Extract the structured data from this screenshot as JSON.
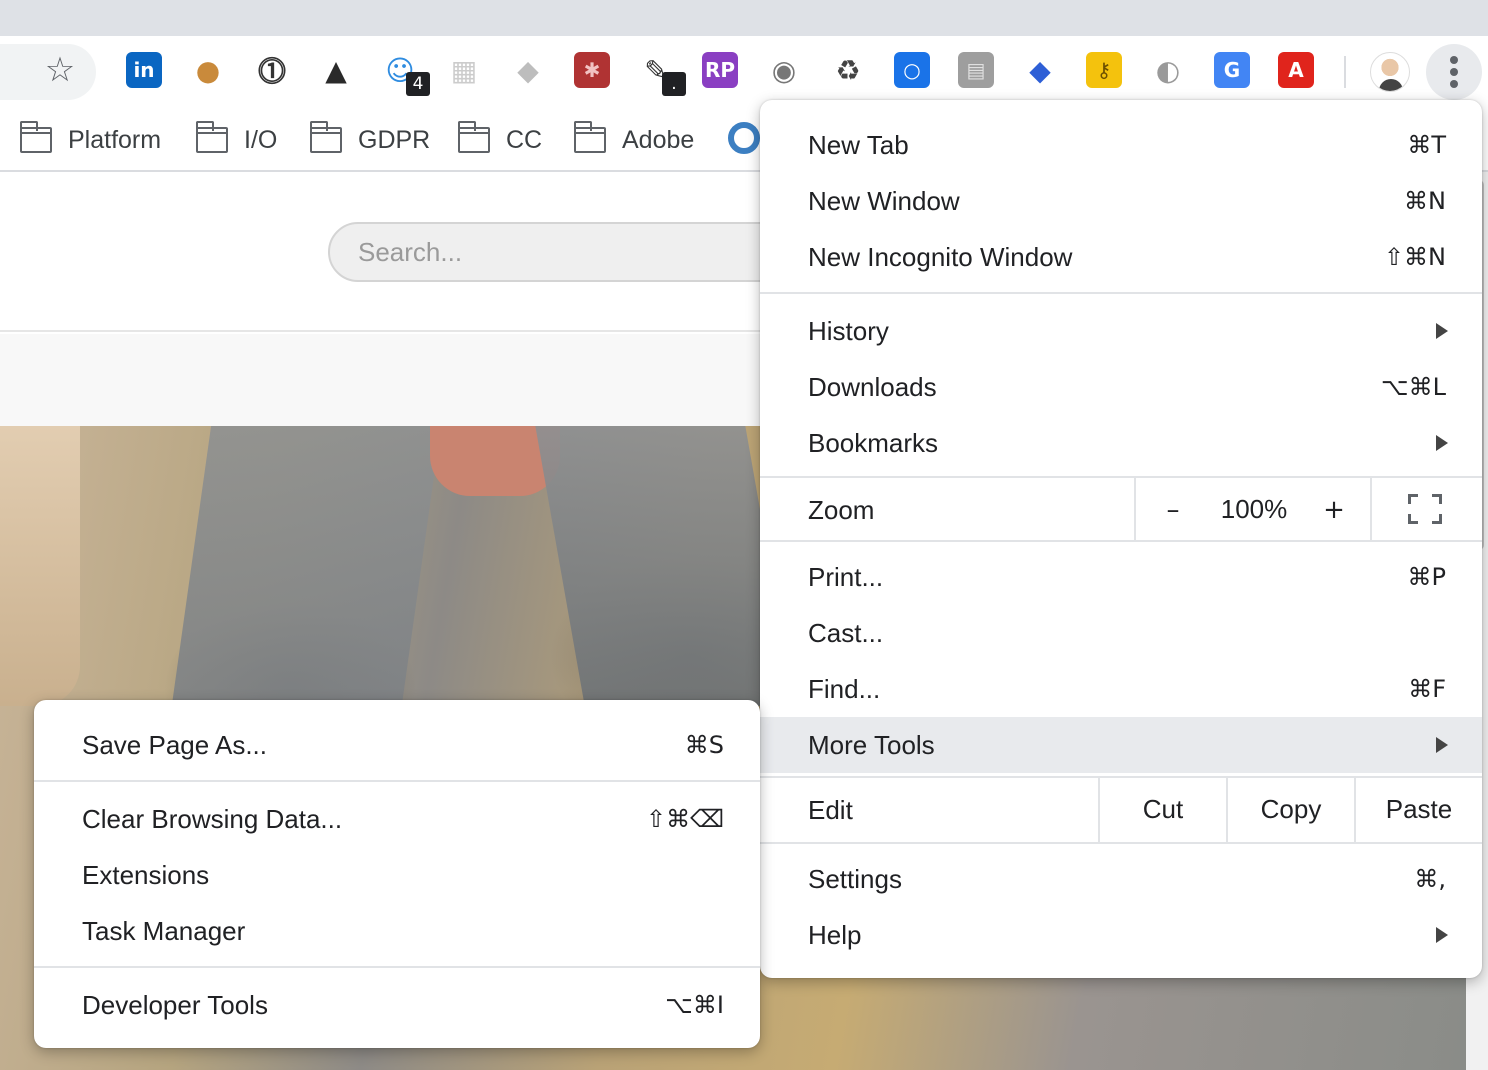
{
  "toolbar": {
    "bookmark_star_icon": "star-icon",
    "extensions": [
      {
        "name": "linkedin-extension-icon",
        "glyph": "in",
        "bg": "#0a66c2",
        "fg": "#ffffff"
      },
      {
        "name": "cookie-extension-icon",
        "glyph": "●",
        "bg": "#ffffff",
        "fg": "#c98a3b"
      },
      {
        "name": "password-manager-extension-icon",
        "glyph": "⓵",
        "bg": "#ffffff",
        "fg": "#333333"
      },
      {
        "name": "color-triangle-extension-icon",
        "glyph": "▲",
        "bg": "#ffffff",
        "fg": "#2a2a2a"
      },
      {
        "name": "ghost-extension-icon",
        "glyph": "☺",
        "bg": "#ffffff",
        "fg": "#2f8ce0",
        "badge": "4"
      },
      {
        "name": "map-extension-icon",
        "glyph": "▦",
        "bg": "#ffffff",
        "fg": "#cccccc"
      },
      {
        "name": "cube-extension-icon",
        "glyph": "◆",
        "bg": "#ffffff",
        "fg": "#bdbdbd"
      },
      {
        "name": "red-square-extension-icon",
        "glyph": "✱",
        "bg": "#b03333",
        "fg": "#f2c2c2"
      },
      {
        "name": "eyedropper-extension-icon",
        "glyph": "✎",
        "bg": "#ffffff",
        "fg": "#333333",
        "badge": "."
      },
      {
        "name": "rp-extension-icon",
        "glyph": "RP",
        "bg": "#8a3fc2",
        "fg": "#ffffff"
      },
      {
        "name": "camera-extension-icon",
        "glyph": "◉",
        "bg": "#ffffff",
        "fg": "#777777"
      },
      {
        "name": "recycle-extension-icon",
        "glyph": "♻",
        "bg": "#ffffff",
        "fg": "#444444"
      },
      {
        "name": "blue-ring-extension-icon",
        "glyph": "○",
        "bg": "#1a73e8",
        "fg": "#ffffff"
      },
      {
        "name": "gray-map-extension-icon",
        "glyph": "▤",
        "bg": "#9e9e9e",
        "fg": "#e0e0e0"
      },
      {
        "name": "ethereum-extension-icon",
        "glyph": "◆",
        "bg": "#ffffff",
        "fg": "#2e5fd6"
      },
      {
        "name": "key-extension-icon",
        "glyph": "⚷",
        "bg": "#f4c20d",
        "fg": "#6b4f00"
      },
      {
        "name": "sphere-extension-icon",
        "glyph": "◐",
        "bg": "#ffffff",
        "fg": "#9a9a9a"
      },
      {
        "name": "translate-extension-icon",
        "glyph": "G",
        "bg": "#4285f4",
        "fg": "#ffffff"
      },
      {
        "name": "adobe-acrobat-extension-icon",
        "glyph": "A",
        "bg": "#e0241c",
        "fg": "#ffffff"
      }
    ]
  },
  "bookmarks": [
    {
      "label": "Platform"
    },
    {
      "label": "I/O"
    },
    {
      "label": "GDPR"
    },
    {
      "label": "CC"
    },
    {
      "label": "Adobe"
    }
  ],
  "page": {
    "search_placeholder": "Search..."
  },
  "main_menu": {
    "new_tab": {
      "label": "New Tab",
      "shortcut": "⌘T"
    },
    "new_window": {
      "label": "New Window",
      "shortcut": "⌘N"
    },
    "new_incognito": {
      "label": "New Incognito Window",
      "shortcut": "⇧⌘N"
    },
    "history": {
      "label": "History"
    },
    "downloads": {
      "label": "Downloads",
      "shortcut": "⌥⌘L"
    },
    "bookmarks": {
      "label": "Bookmarks"
    },
    "zoom": {
      "label": "Zoom",
      "minus": "–",
      "value": "100%",
      "plus": "+"
    },
    "print": {
      "label": "Print...",
      "shortcut": "⌘P"
    },
    "cast": {
      "label": "Cast..."
    },
    "find": {
      "label": "Find...",
      "shortcut": "⌘F"
    },
    "more_tools": {
      "label": "More Tools"
    },
    "edit": {
      "label": "Edit",
      "cut": "Cut",
      "copy": "Copy",
      "paste": "Paste"
    },
    "settings": {
      "label": "Settings",
      "shortcut": "⌘,"
    },
    "help": {
      "label": "Help"
    }
  },
  "more_tools_menu": {
    "save_page": {
      "label": "Save Page As...",
      "shortcut": "⌘S"
    },
    "clear_browsing": {
      "label": "Clear Browsing Data...",
      "shortcut": "⇧⌘⌫"
    },
    "extensions": {
      "label": "Extensions"
    },
    "task_manager": {
      "label": "Task Manager"
    },
    "developer_tools": {
      "label": "Developer Tools",
      "shortcut": "⌥⌘I"
    }
  }
}
